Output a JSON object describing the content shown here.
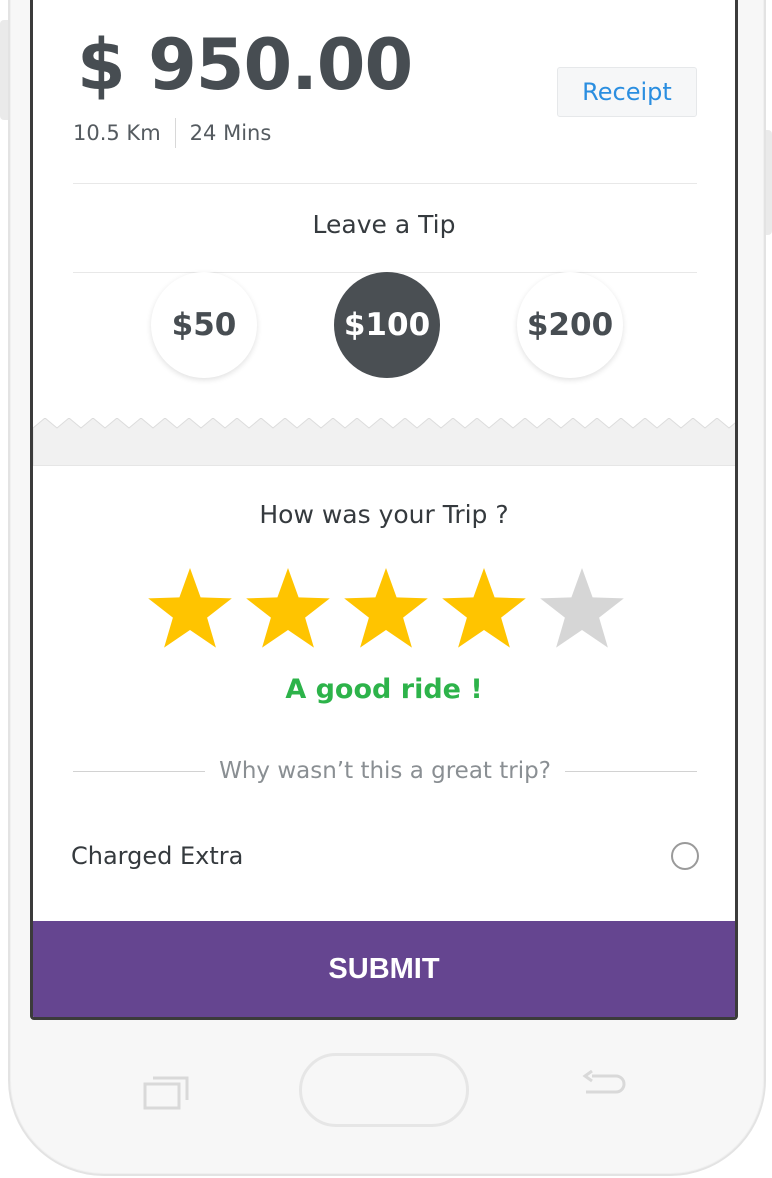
{
  "trip": {
    "fare": "$ 950.00",
    "distance": "10.5 Km",
    "duration": "24 Mins",
    "receipt_label": "Receipt"
  },
  "tip": {
    "title": "Leave a Tip",
    "options": [
      "$50",
      "$100",
      "$200"
    ],
    "selected": "$100"
  },
  "rating": {
    "title": "How was your Trip ?",
    "stars_filled": 4,
    "stars_total": 5,
    "label": "A good ride !"
  },
  "feedback": {
    "question": "Why wasn’t this a great trip?",
    "options": [
      {
        "label": "Charged Extra",
        "checked": false
      }
    ]
  },
  "submit_label": "SUBMIT",
  "colors": {
    "accent": "#654590",
    "link": "#2a8ee0",
    "star_filled": "#ffc400",
    "star_empty": "#d6d6d6",
    "positive": "#2db34a",
    "selected_tip": "#4a4f53"
  },
  "icons": {
    "nav_recent": "recent-apps-icon",
    "nav_home": "home-button",
    "nav_back": "back-icon"
  }
}
